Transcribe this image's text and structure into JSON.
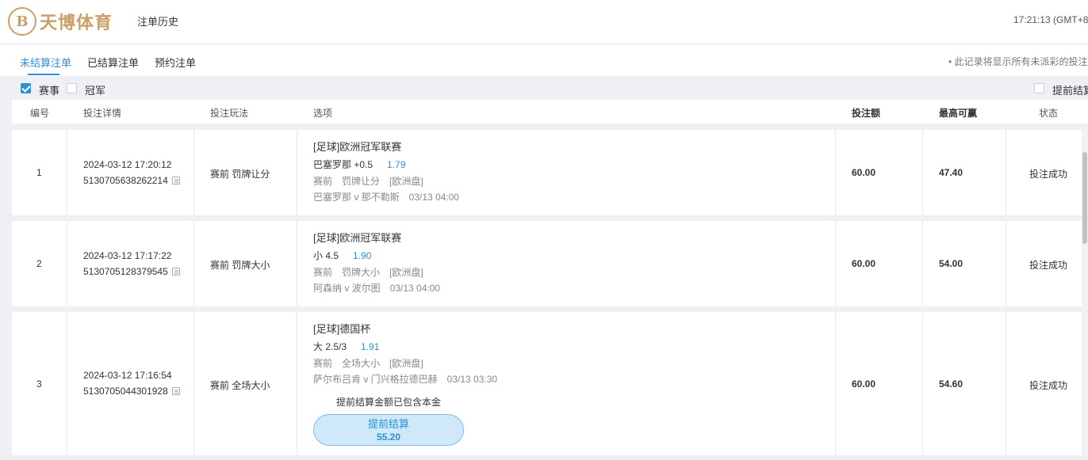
{
  "header": {
    "logo_text": "天博体育",
    "logo_glyph": "B",
    "page_title": "注单历史",
    "clock": "17:21:13 (GMT+8)"
  },
  "tabs": [
    {
      "label": "未结算注单",
      "active": true
    },
    {
      "label": "已结算注单",
      "active": false
    },
    {
      "label": "预约注单",
      "active": false
    }
  ],
  "notice": "• 此记录将显示所有未派彩的投注",
  "filters": {
    "event": {
      "label": "赛事",
      "checked": true
    },
    "champion": {
      "label": "冠军",
      "checked": false
    },
    "early_settle": {
      "label": "提前结算",
      "checked": false
    }
  },
  "columns": {
    "no": "编号",
    "detail": "投注详情",
    "play": "投注玩法",
    "selection": "选项",
    "stake": "投注额",
    "max_win": "最高可赢",
    "status": "状态"
  },
  "bets": [
    {
      "no": "1",
      "time": "2024-03-12 17:20:12",
      "ticket": "5130705638262214",
      "play": "赛前 罚牌让分",
      "league": "[足球]欧洲冠军联赛",
      "pick": "巴塞罗那 +0.5",
      "odds": "1.79",
      "meta_a": "赛前",
      "meta_b": "罚牌让分",
      "meta_c": "[欧洲盘]",
      "match": "巴塞罗那 v 那不勒斯",
      "match_time": "03/13 04:00",
      "stake": "60.00",
      "max_win": "47.40",
      "status": "投注成功"
    },
    {
      "no": "2",
      "time": "2024-03-12 17:17:22",
      "ticket": "5130705128379545",
      "play": "赛前 罚牌大小",
      "league": "[足球]欧洲冠军联赛",
      "pick": "小 4.5",
      "odds": "1.90",
      "meta_a": "赛前",
      "meta_b": "罚牌大小",
      "meta_c": "[欧洲盘]",
      "match": "阿森纳 v 波尔图",
      "match_time": "03/13 04:00",
      "stake": "60.00",
      "max_win": "54.00",
      "status": "投注成功"
    },
    {
      "no": "3",
      "time": "2024-03-12 17:16:54",
      "ticket": "5130705044301928",
      "play": "赛前 全场大小",
      "league": "[足球]德国杯",
      "pick": "大 2.5/3",
      "odds": "1.91",
      "meta_a": "赛前",
      "meta_b": "全场大小",
      "meta_c": "[欧洲盘]",
      "match": "萨尔布吕肯 v 门兴格拉德巴赫",
      "match_time": "03/13 03:30",
      "stake": "60.00",
      "max_win": "54.60",
      "status": "投注成功",
      "cashout_note": "提前结算金额已包含本金",
      "cashout_label": "提前结算",
      "cashout_value": "55.20"
    }
  ],
  "colors": {
    "accent": "#2e8fd6",
    "logo_gold": "#c9a06a",
    "cashout_bg": "#cfe9fb"
  }
}
